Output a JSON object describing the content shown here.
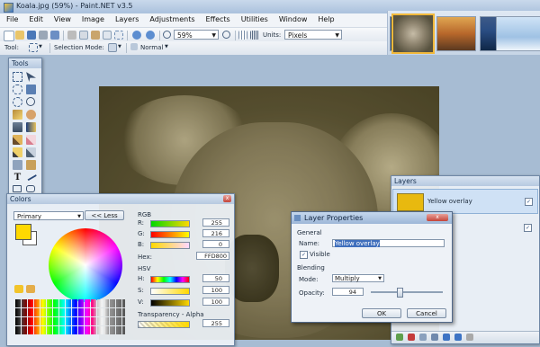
{
  "window": {
    "title": "Koala.jpg (59%) - Paint.NET v3.5"
  },
  "menu": [
    "File",
    "Edit",
    "View",
    "Image",
    "Layers",
    "Adjustments",
    "Effects",
    "Utilities",
    "Window",
    "Help"
  ],
  "toolbar": {
    "zoom": "59%",
    "units_label": "Units:",
    "units_value": "Pixels"
  },
  "toolbar2": {
    "tool_label": "Tool:",
    "selection_mode_label": "Selection Mode:",
    "blend_mode": "Normal"
  },
  "tools_panel": {
    "title": "Tools"
  },
  "colors_panel": {
    "title": "Colors",
    "primary_select": "Primary",
    "less_button": "<< Less",
    "rgb_label": "RGB",
    "r_label": "R:",
    "r_value": "255",
    "g_label": "G:",
    "g_value": "216",
    "b_label": "B:",
    "b_value": "0",
    "hex_label": "Hex:",
    "hex_value": "FFD800",
    "hsv_label": "HSV",
    "h_label": "H:",
    "h_value": "50",
    "s_label": "S:",
    "s_value": "100",
    "v_label": "V:",
    "v_value": "100",
    "transparency_label": "Transparency - Alpha",
    "alpha_value": "255",
    "primary_color": "#FFD800"
  },
  "layers_panel": {
    "title": "Layers",
    "layers": [
      {
        "name": "Yellow overlay",
        "visible": true,
        "selected": true
      }
    ]
  },
  "layer_properties": {
    "title": "Layer Properties",
    "general_label": "General",
    "name_label": "Name:",
    "name_value": "Yellow overlay",
    "visible_label": "Visible",
    "blending_label": "Blending",
    "mode_label": "Mode:",
    "mode_value": "Multiply",
    "opacity_label": "Opacity:",
    "opacity_value": "94",
    "ok_label": "OK",
    "cancel_label": "Cancel"
  }
}
